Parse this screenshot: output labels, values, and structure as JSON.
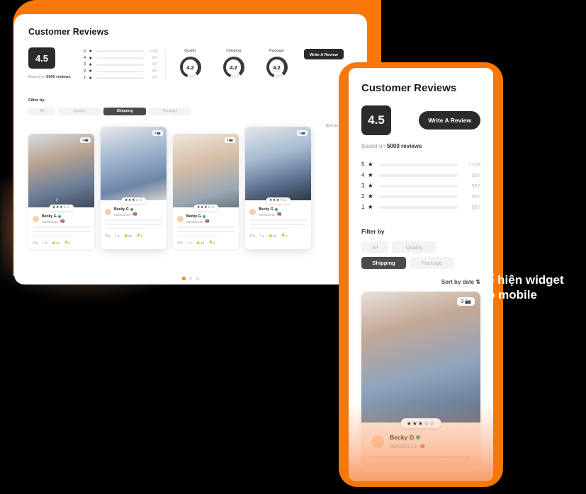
{
  "theme": {
    "brand_orange": "#F97706",
    "accent_dot": "#F7921E",
    "dark": "#2B2B2B",
    "page_background": "#000000"
  },
  "desktop": {
    "title": "Customer Reviews",
    "overall_score": "4.5",
    "based_on_prefix": "Based on ",
    "based_on_value": "5000 reviews",
    "write_review_label": "Write A Review",
    "rating_breakdown": [
      {
        "level": "5",
        "star": "★",
        "count": "1208",
        "percent": 82
      },
      {
        "level": "4",
        "star": "★",
        "count": "987",
        "percent": 70
      },
      {
        "level": "3",
        "star": "★",
        "count": "987",
        "percent": 70
      },
      {
        "level": "2",
        "star": "★",
        "count": "987",
        "percent": 70
      },
      {
        "level": "1",
        "star": "★",
        "count": "987",
        "percent": 70
      }
    ],
    "gauges": [
      {
        "label": "Quality",
        "value": "4.2"
      },
      {
        "label": "Shipping",
        "value": "4.2"
      },
      {
        "label": "Package",
        "value": "4.2"
      }
    ],
    "filter_label": "Filter by",
    "filters": [
      {
        "label": "All",
        "active": false
      },
      {
        "label": "Quality",
        "active": false
      },
      {
        "label": "Shipping",
        "active": true
      },
      {
        "label": "Package",
        "active": false
      }
    ],
    "sort_label": "Sort by date",
    "sort_icon": "⇅",
    "prev_icon": "‹",
    "next_icon": "›",
    "cards": [
      {
        "photo_count": "3",
        "camera_icon": "📷",
        "stars": "★★★☆☆",
        "user": "Becky G",
        "date": "05/06/2019",
        "flag": "🇬🇧",
        "photos_count": "5",
        "replies_count": "1",
        "likes_count": "12",
        "dislikes_count": "0"
      },
      {
        "photo_count": "3",
        "camera_icon": "📷",
        "stars": "★★★☆☆",
        "user": "Becky G",
        "date": "05/06/2019",
        "flag": "🇬🇧",
        "photos_count": "5",
        "replies_count": "1",
        "likes_count": "12",
        "dislikes_count": "0"
      },
      {
        "photo_count": "3",
        "camera_icon": "📷",
        "stars": "★★★☆☆",
        "user": "Becky G",
        "date": "05/06/2019",
        "flag": "🇬🇧",
        "photos_count": "5",
        "replies_count": "1",
        "likes_count": "12",
        "dislikes_count": "0"
      },
      {
        "photo_count": "3",
        "camera_icon": "📷",
        "stars": "★★★☆☆",
        "user": "Becky G",
        "date": "05/06/2019",
        "flag": "🇬🇧",
        "photos_count": "5",
        "replies_count": "1",
        "likes_count": "12",
        "dislikes_count": "0"
      }
    ],
    "pagination_dots": 3,
    "active_dot_index": 0,
    "footer_icons": {
      "photos": "▤",
      "reply": "↩",
      "like": "👍",
      "dislike": "👎"
    }
  },
  "mobile": {
    "title": "Customer Reviews",
    "overall_score": "4.5",
    "write_review_label": "Write A Review",
    "based_on_prefix": "Based on ",
    "based_on_value": "5000 reviews",
    "rating_breakdown": [
      {
        "level": "5",
        "star": "★",
        "count": "1208",
        "percent": 82
      },
      {
        "level": "4",
        "star": "★",
        "count": "987",
        "percent": 66
      },
      {
        "level": "3",
        "star": "★",
        "count": "987",
        "percent": 70
      },
      {
        "level": "2",
        "star": "★",
        "count": "987",
        "percent": 66
      },
      {
        "level": "1",
        "star": "★",
        "count": "987",
        "percent": 66
      }
    ],
    "filter_label": "Filter by",
    "filters": [
      {
        "label": "All",
        "active": false
      },
      {
        "label": "Quality",
        "active": false
      },
      {
        "label": "Shipping",
        "active": true
      },
      {
        "label": "Package",
        "active": false
      }
    ],
    "sort_label": "Sort by date",
    "sort_icon": "⇅",
    "card": {
      "photo_count": "3",
      "camera_icon": "📷",
      "stars": "★★★☆☆",
      "user": "Becky G",
      "date": "05/06/2019",
      "flag": "🇬🇧"
    }
  },
  "caption": {
    "line1": "ể hiện widget",
    "line2": "o mobile"
  }
}
